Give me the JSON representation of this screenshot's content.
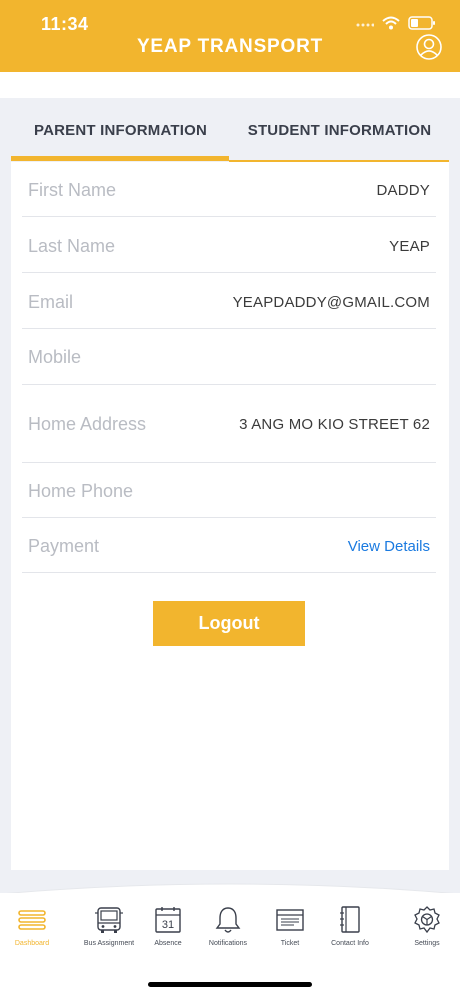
{
  "status_bar": {
    "time": "11:34"
  },
  "header": {
    "title": "YEAP TRANSPORT"
  },
  "tabs": [
    {
      "label": "PARENT INFORMATION",
      "active": true
    },
    {
      "label": "STUDENT INFORMATION",
      "active": false
    }
  ],
  "fields": [
    {
      "label": "First Name",
      "value": "DADDY"
    },
    {
      "label": "Last Name",
      "value": "YEAP"
    },
    {
      "label": "Email",
      "value": "YEAPDADDY@GMAIL.COM"
    },
    {
      "label": "Mobile",
      "value": ""
    },
    {
      "label": "Home Address",
      "value": "3 ANG MO KIO STREET 62"
    },
    {
      "label": "Home Phone",
      "value": ""
    },
    {
      "label": "Payment",
      "link": "View Details"
    }
  ],
  "logout_label": "Logout",
  "nav": [
    {
      "label": "Dashboard",
      "icon": "menu-icon",
      "active": true
    },
    {
      "label": "Bus Assignment",
      "icon": "bus-icon"
    },
    {
      "label": "Absence",
      "icon": "calendar-icon",
      "day": "31"
    },
    {
      "label": "Notifications",
      "icon": "bell-icon"
    },
    {
      "label": "Ticket",
      "icon": "ticket-icon"
    },
    {
      "label": "Contact Info",
      "icon": "contact-book-icon"
    },
    {
      "label": "Settings",
      "icon": "gear-icon"
    }
  ],
  "colors": {
    "accent": "#f2b52e",
    "link": "#1a7ae0",
    "background": "#eef0f5"
  }
}
